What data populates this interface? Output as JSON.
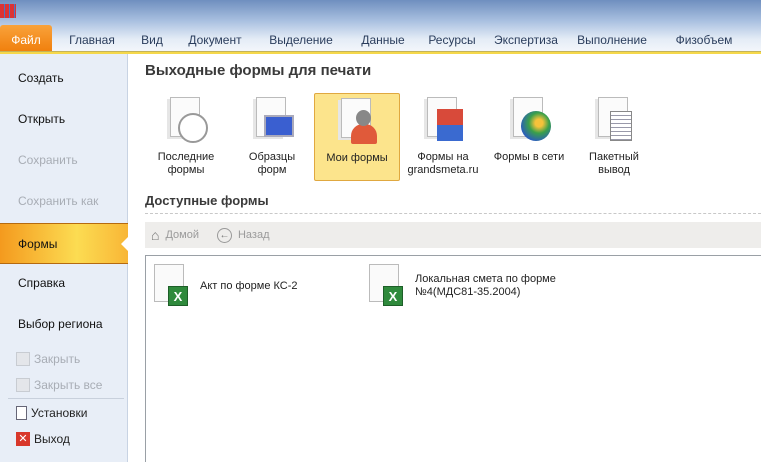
{
  "tabs": [
    "Файл",
    "Главная",
    "Вид",
    "Документ",
    "Выделение",
    "Данные",
    "Ресурсы",
    "Экспертиза",
    "Выполнение",
    "Физобъем"
  ],
  "sidebar": {
    "create": "Создать",
    "open": "Открыть",
    "save": "Сохранить",
    "save_as": "Сохранить как",
    "forms": "Формы",
    "help": "Справка",
    "region": "Выбор региона",
    "close": "Закрыть",
    "close_all": "Закрыть все",
    "settings": "Установки",
    "exit": "Выход"
  },
  "main": {
    "title": "Выходные формы для печати",
    "buttons": [
      {
        "l1": "Последние",
        "l2": "формы"
      },
      {
        "l1": "Образцы",
        "l2": "форм"
      },
      {
        "l1": "Мои формы",
        "l2": ""
      },
      {
        "l1": "Формы на",
        "l2": "grandsmeta.ru"
      },
      {
        "l1": "Формы в сети",
        "l2": ""
      },
      {
        "l1": "Пакетный",
        "l2": "вывод"
      }
    ],
    "available": "Доступные формы",
    "home": "Домой",
    "back": "Назад",
    "files": [
      {
        "l1": "Акт по форме КС-2",
        "l2": ""
      },
      {
        "l1": "Локальная смета по форме",
        "l2": "№4(МДС81-35.2004)"
      }
    ]
  }
}
